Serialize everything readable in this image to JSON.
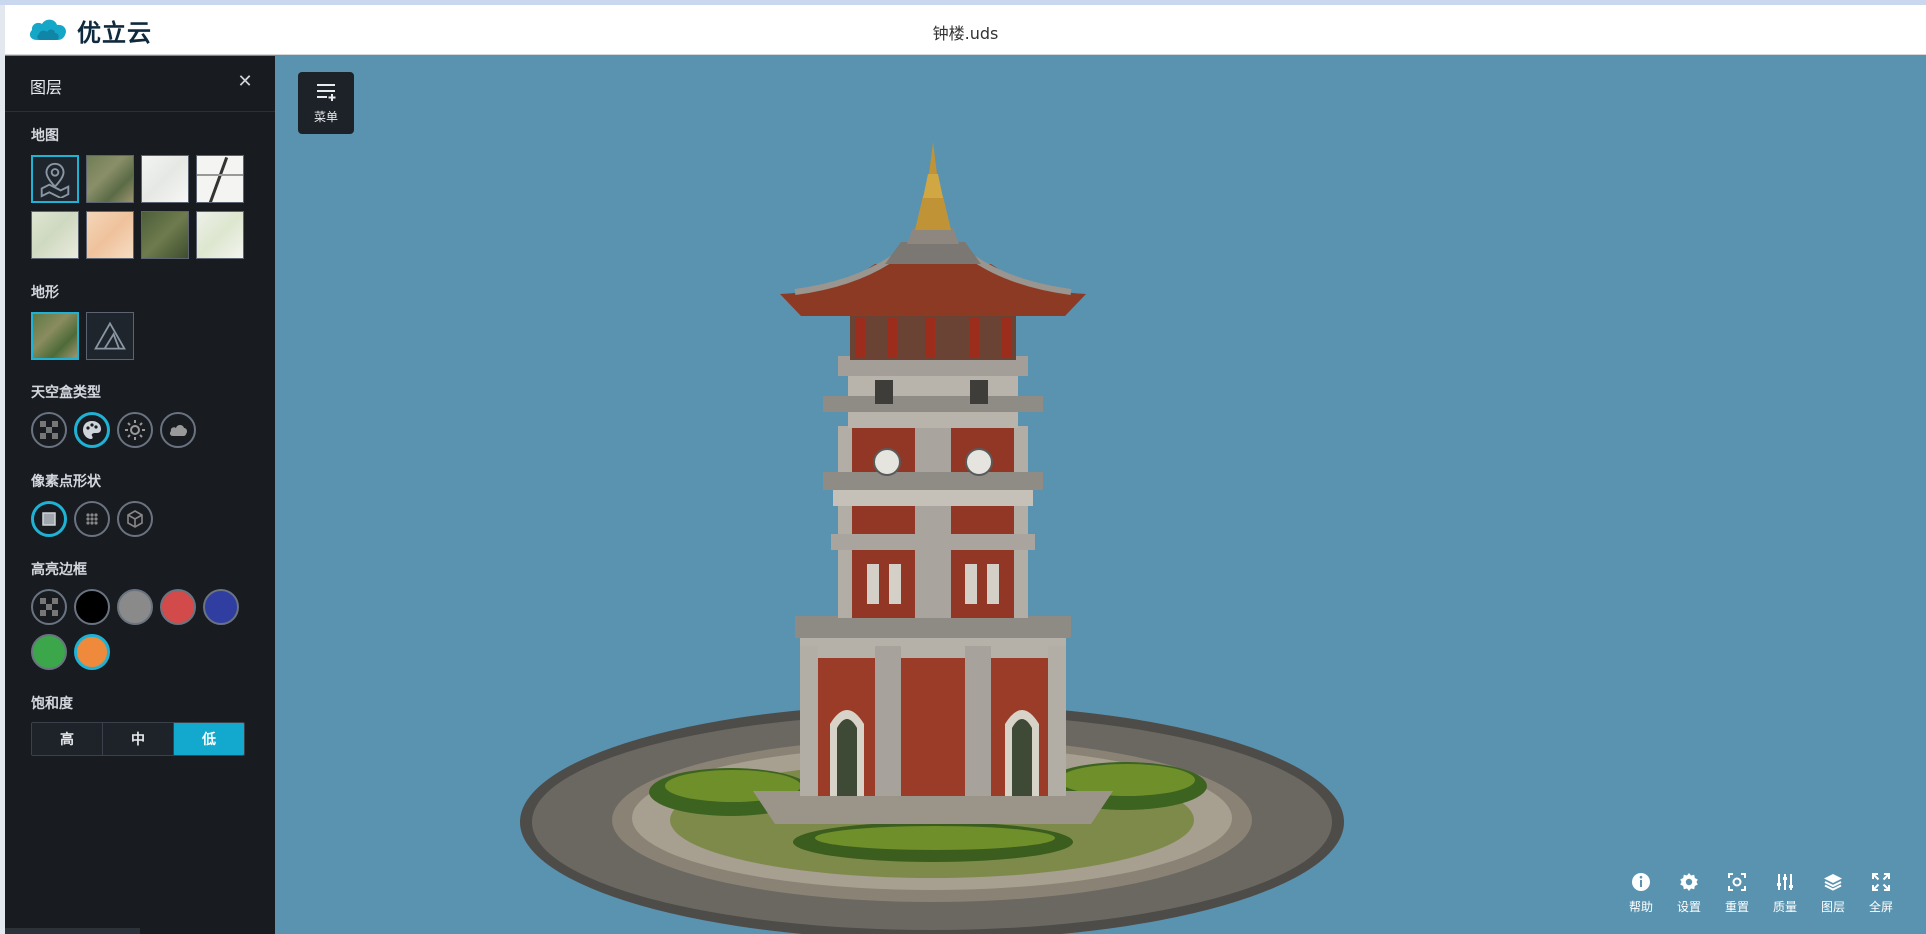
{
  "app": {
    "brand": "优立云",
    "file_title": "钟楼.uds"
  },
  "sidebar": {
    "title": "图层",
    "close_icon": "close-icon",
    "sections": {
      "map": "地图",
      "terrain": "地形",
      "skybox": "天空盒类型",
      "point_shape": "像素点形状",
      "highlight": "高亮边框",
      "saturation": "饱和度"
    },
    "saturation_options": [
      "高",
      "中",
      "低"
    ],
    "saturation_selected": "低",
    "highlight_colors": [
      "#000000",
      "#8a8a8a",
      "#d24a4a",
      "#2f3ea0",
      "#3ba64a",
      "#ef8a3c"
    ]
  },
  "menu": {
    "label": "菜单"
  },
  "toolbar": {
    "items": [
      {
        "label": "帮助",
        "icon": "info-icon"
      },
      {
        "label": "设置",
        "icon": "gear-icon"
      },
      {
        "label": "重置",
        "icon": "reset-view-icon"
      },
      {
        "label": "质量",
        "icon": "sliders-icon"
      },
      {
        "label": "图层",
        "icon": "layers-icon"
      },
      {
        "label": "全屏",
        "icon": "fullscreen-icon"
      }
    ]
  }
}
